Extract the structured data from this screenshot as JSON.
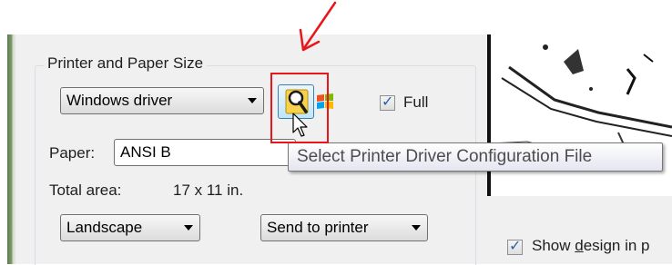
{
  "printer_group": {
    "title": "Printer and Paper Size",
    "driver_select_value": "Windows driver",
    "full_checkbox": {
      "label": "Full",
      "checked": true
    },
    "paper_label": "Paper:",
    "paper_value": "ANSI B",
    "total_area_label": "Total area:",
    "total_area_value": "17 x 11 in.",
    "orientation_value": "Landscape",
    "output_value": "Send to printer"
  },
  "tooltip": {
    "text": "Select Printer Driver Configuration File"
  },
  "show_design": {
    "label_prefix": "Show ",
    "label_underlined": "d",
    "label_rest": "esign in p",
    "checked": true
  },
  "icons": {
    "config_button": "magnifier-icon",
    "windows_logo": "windows-logo-icon",
    "cursor": "mouse-pointer-icon",
    "annotation_arrow": "red-arrow-icon"
  },
  "colors": {
    "annotation_red": "#e8161b",
    "tooltip_text": "#4d4d4d",
    "checkbox_tick": "#2a5fa8"
  }
}
